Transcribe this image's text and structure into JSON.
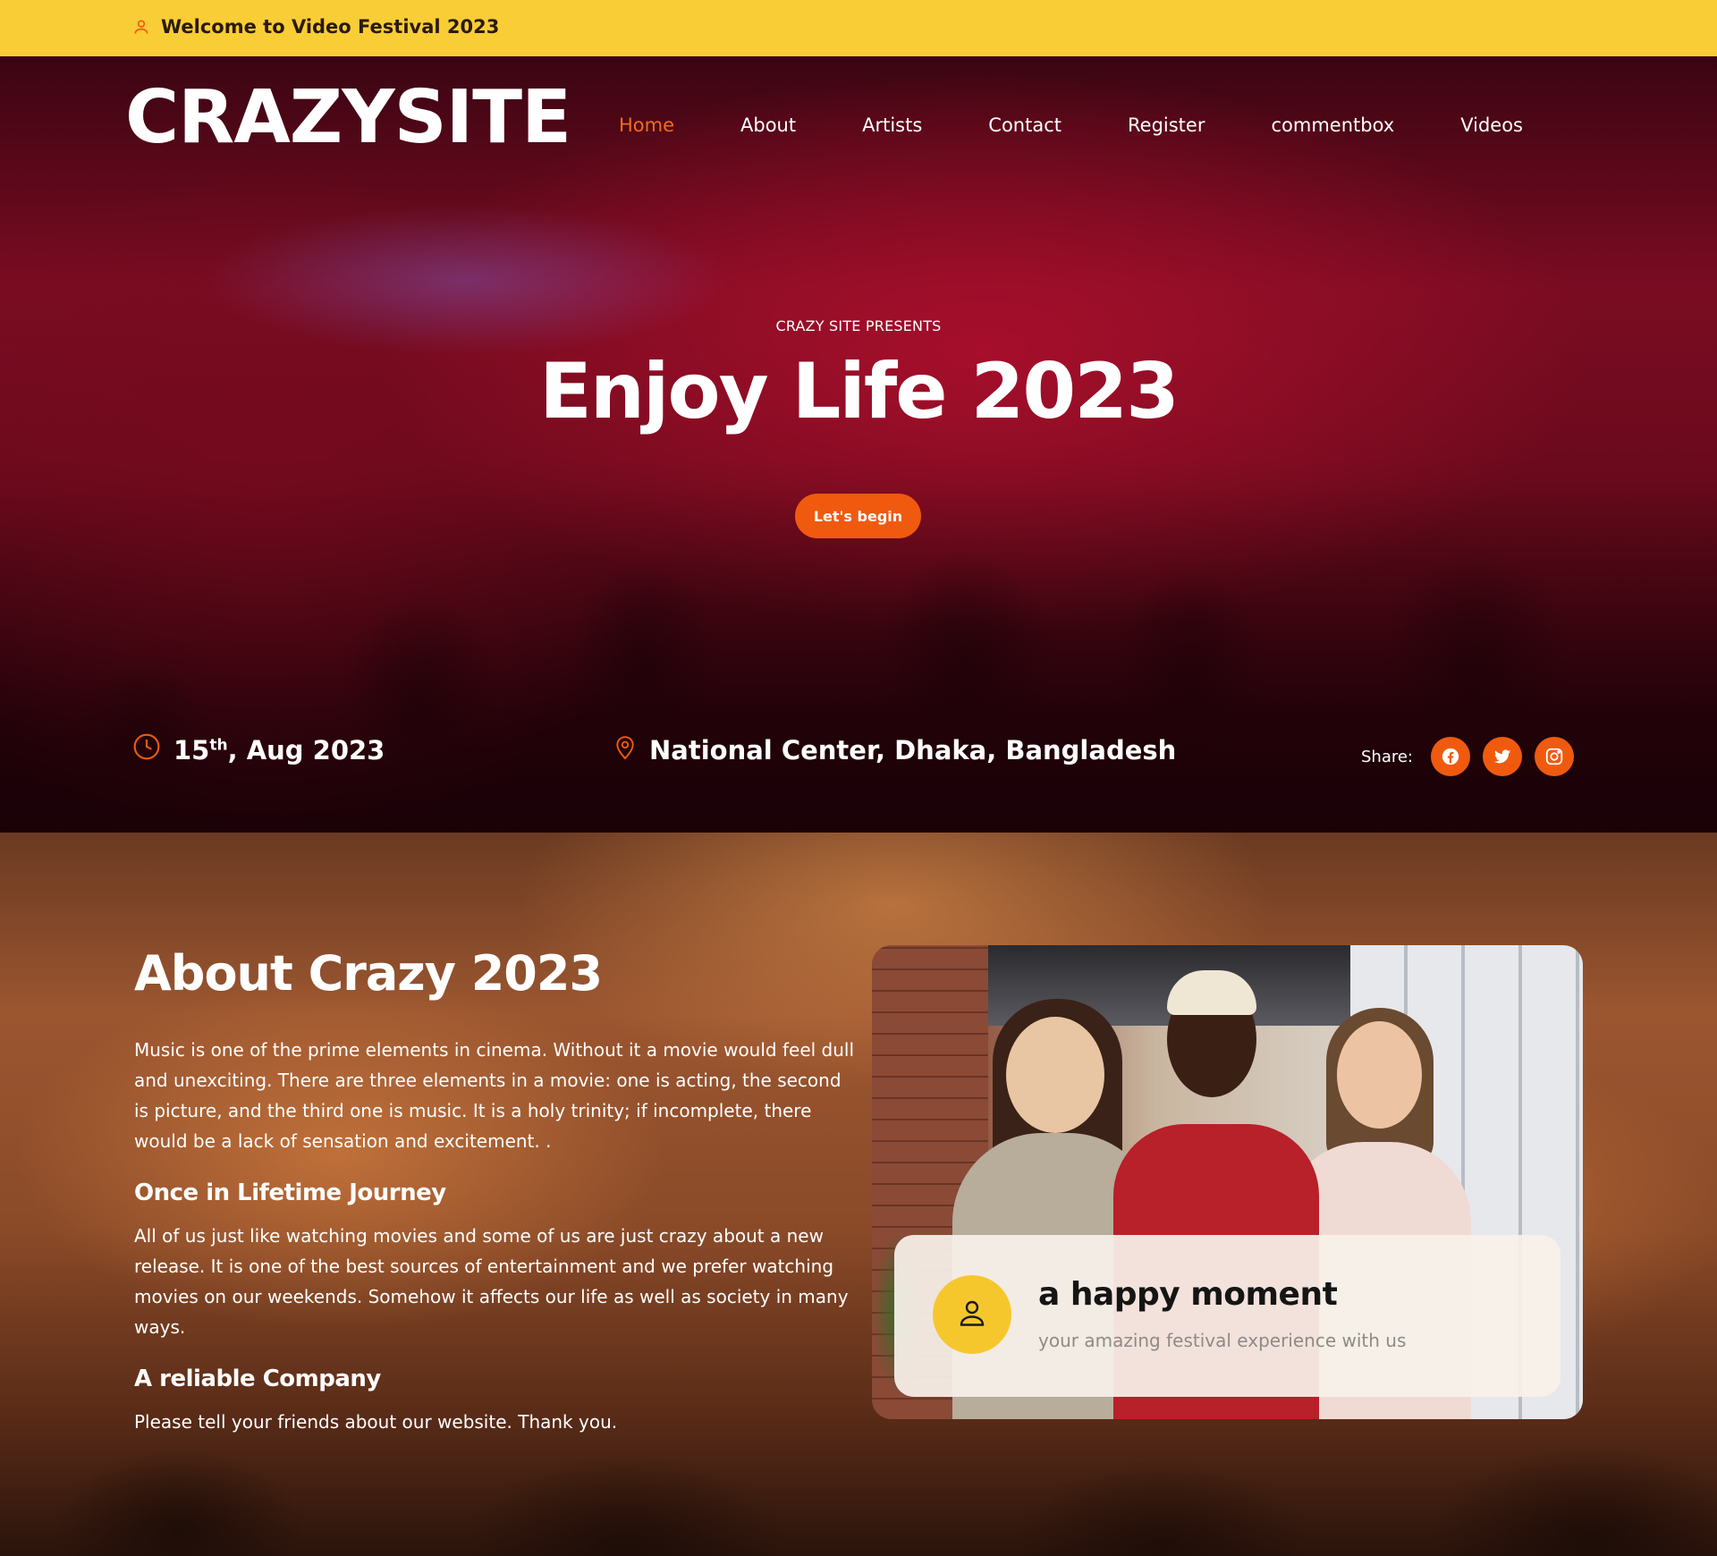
{
  "topbar": {
    "welcome_text": "Welcome to Video Festival 2023",
    "icon": "user-icon"
  },
  "header": {
    "logo": "CRAZYSITE",
    "nav": [
      {
        "label": "Home",
        "active": true
      },
      {
        "label": "About",
        "active": false
      },
      {
        "label": "Artists",
        "active": false
      },
      {
        "label": "Contact",
        "active": false
      },
      {
        "label": "Register",
        "active": false
      },
      {
        "label": "commentbox",
        "active": false
      },
      {
        "label": "Videos",
        "active": false
      }
    ]
  },
  "hero": {
    "presents": "CRAZY SITE PRESENTS",
    "title": "Enjoy Life 2023",
    "cta_label": "Let's begin",
    "date_day": "15",
    "date_suffix": "th",
    "date_rest": ", Aug 2023",
    "location": "National Center, Dhaka, Bangladesh",
    "share_label": "Share:",
    "share_icons": [
      "facebook-icon",
      "twitter-icon",
      "instagram-icon"
    ]
  },
  "about": {
    "title": "About Crazy 2023",
    "intro": "Music is one of the prime elements in cinema. Without it a movie would feel dull and unexciting. There are three elements in a movie: one is acting, the second is picture, and the third one is music. It is a holy trinity; if incomplete, there would be a lack of sensation and excitement. .",
    "sections": [
      {
        "heading": "Once in Lifetime Journey",
        "text": "All of us just like watching movies and some of us are just crazy about a new release. It is one of the best sources of entertainment and we prefer watching movies on our weekends. Somehow it affects our life as well as society in many ways."
      },
      {
        "heading": "A reliable Company",
        "text": "Please tell your friends about our website. Thank you."
      }
    ],
    "card": {
      "title": "a happy moment",
      "subtitle": "your amazing festival experience with us"
    }
  },
  "colors": {
    "topbar_bg": "#f9cd36",
    "accent_orange": "#ef5a0f",
    "avatar_yellow": "#f6c72d"
  }
}
